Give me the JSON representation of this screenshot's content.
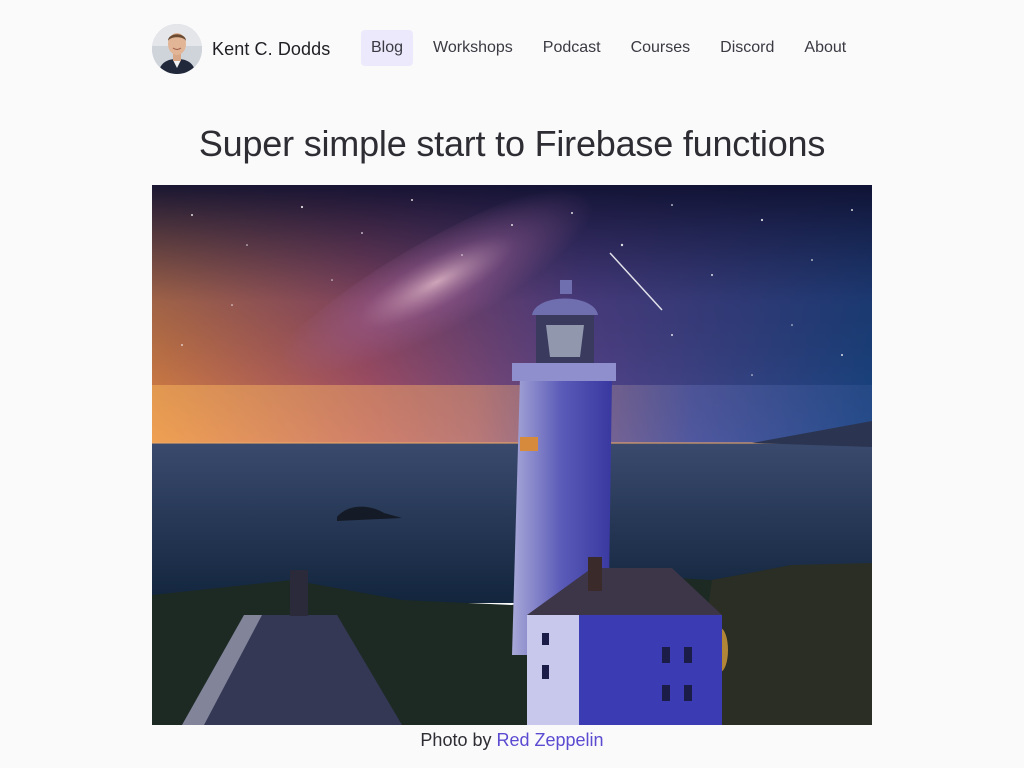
{
  "site": {
    "brand_name": "Kent C. Dodds"
  },
  "nav": {
    "items": [
      {
        "label": "Blog",
        "active": true
      },
      {
        "label": "Workshops",
        "active": false
      },
      {
        "label": "Podcast",
        "active": false
      },
      {
        "label": "Courses",
        "active": false
      },
      {
        "label": "Discord",
        "active": false
      },
      {
        "label": "About",
        "active": false
      }
    ]
  },
  "article": {
    "title": "Super simple start to Firebase functions"
  },
  "caption": {
    "prefix": "Photo by",
    "credit_name": "Red Zeppelin"
  },
  "colors": {
    "accent": "#5b4bd1",
    "active_nav_bg": "#ebe9fb",
    "page_bg": "#fafafb"
  }
}
